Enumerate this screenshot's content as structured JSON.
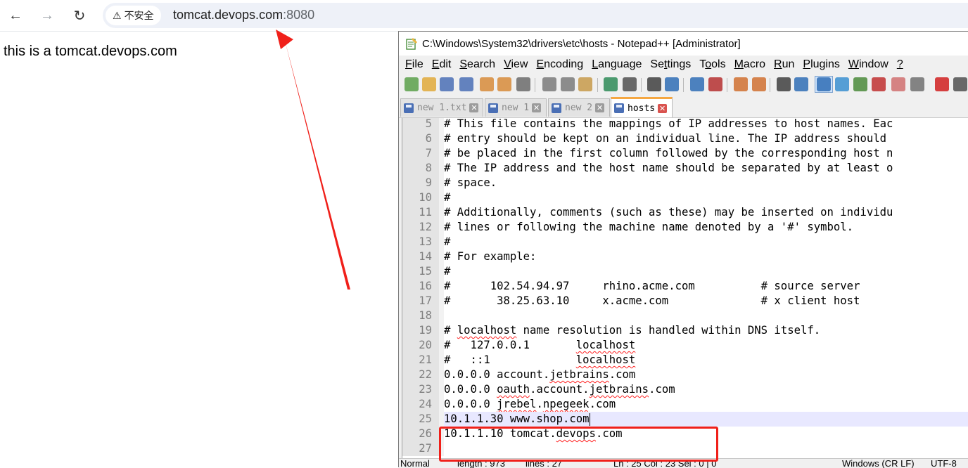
{
  "browser": {
    "security_label": "不安全",
    "url_host": "tomcat.devops.com",
    "url_port": ":8080",
    "icons": {
      "back": "back-arrow-icon",
      "forward": "forward-arrow-icon",
      "reload": "reload-icon",
      "warning": "warning-icon"
    }
  },
  "page": {
    "body_text": "this is a tomcat.devops.com"
  },
  "notepad": {
    "title": "C:\\Windows\\System32\\drivers\\etc\\hosts - Notepad++ [Administrator]",
    "menu": [
      {
        "pre": "",
        "ul": "F",
        "post": "ile"
      },
      {
        "pre": "",
        "ul": "E",
        "post": "dit"
      },
      {
        "pre": "",
        "ul": "S",
        "post": "earch"
      },
      {
        "pre": "",
        "ul": "V",
        "post": "iew"
      },
      {
        "pre": "",
        "ul": "E",
        "post": "ncoding"
      },
      {
        "pre": "",
        "ul": "L",
        "post": "anguage"
      },
      {
        "pre": "Se",
        "ul": "t",
        "post": "tings"
      },
      {
        "pre": "T",
        "ul": "o",
        "post": "ols"
      },
      {
        "pre": "",
        "ul": "M",
        "post": "acro"
      },
      {
        "pre": "",
        "ul": "R",
        "post": "un"
      },
      {
        "pre": "",
        "ul": "P",
        "post": "lugins"
      },
      {
        "pre": "",
        "ul": "W",
        "post": "indow"
      },
      {
        "pre": "",
        "ul": "?",
        "post": ""
      }
    ],
    "tabs": [
      {
        "label": "new 1.txt",
        "active": false
      },
      {
        "label": "new 1",
        "active": false
      },
      {
        "label": "new 2",
        "active": false
      },
      {
        "label": "hosts",
        "active": true
      }
    ],
    "lines": [
      {
        "n": "5",
        "text": "# This file contains the mappings of IP addresses to host names. Eac"
      },
      {
        "n": "6",
        "text": "# entry should be kept on an individual line. The IP address should"
      },
      {
        "n": "7",
        "text": "# be placed in the first column followed by the corresponding host n"
      },
      {
        "n": "8",
        "text": "# The IP address and the host name should be separated by at least o"
      },
      {
        "n": "9",
        "text": "# space."
      },
      {
        "n": "10",
        "text": "#"
      },
      {
        "n": "11",
        "text": "# Additionally, comments (such as these) may be inserted on individu"
      },
      {
        "n": "12",
        "text": "# lines or following the machine name denoted by a '#' symbol."
      },
      {
        "n": "13",
        "text": "#"
      },
      {
        "n": "14",
        "text": "# For example:"
      },
      {
        "n": "15",
        "text": "#"
      },
      {
        "n": "16",
        "text": "#      102.54.94.97     rhino.acme.com          # source server"
      },
      {
        "n": "17",
        "text": "#       38.25.63.10     x.acme.com              # x client host"
      },
      {
        "n": "18",
        "text": ""
      },
      {
        "n": "19",
        "text": "# localhost name resolution is handled within DNS itself."
      },
      {
        "n": "20",
        "text": "#   127.0.0.1       localhost"
      },
      {
        "n": "21",
        "text": "#   ::1             localhost"
      },
      {
        "n": "22",
        "text": "0.0.0.0 account.jetbrains.com"
      },
      {
        "n": "23",
        "text": "0.0.0.0 oauth.account.jetbrains.com"
      },
      {
        "n": "24",
        "text": "0.0.0.0 jrebel.npegeek.com"
      },
      {
        "n": "25",
        "text": "10.1.1.30 www.shop.com"
      },
      {
        "n": "26",
        "text": "10.1.1.10 tomcat.devops.com"
      },
      {
        "n": "27",
        "text": ""
      }
    ],
    "status": {
      "type": "Normal",
      "length": "length : 973",
      "lines": "lines : 27",
      "position": "Ln : 25    Col : 23    Sel : 0 | 0",
      "eol": "Windows (CR LF)",
      "encoding": "UTF-8"
    }
  },
  "colors": {
    "annotation": "#f0201a",
    "current_line": "#e8e8ff",
    "active_tab_accent": "#f5a742"
  }
}
